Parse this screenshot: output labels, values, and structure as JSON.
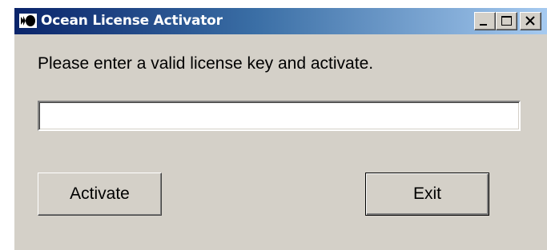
{
  "window": {
    "title": "Ocean License Activator",
    "app_icon": "ocean-logo-icon",
    "controls": {
      "minimize_icon": "minimize-icon",
      "maximize_icon": "maximize-icon",
      "close_icon": "close-icon"
    }
  },
  "main": {
    "prompt": "Please enter a valid license key and activate.",
    "license_input": {
      "value": "",
      "placeholder": ""
    },
    "buttons": {
      "activate_label": "Activate",
      "exit_label": "Exit"
    }
  },
  "colors": {
    "titlebar_start": "#0a246a",
    "titlebar_end": "#a6caf0",
    "window_face": "#d4d0c8"
  }
}
